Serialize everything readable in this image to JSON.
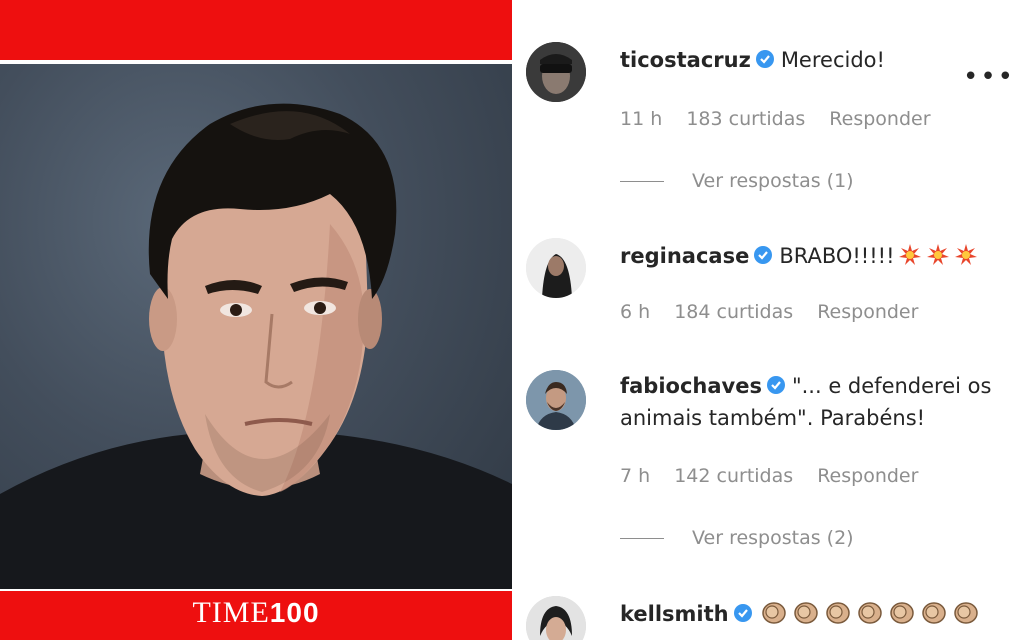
{
  "post": {
    "logo_word": "TIME",
    "logo_number": "100",
    "colors": {
      "banner_red": "#ee0f0f",
      "background": "#4a5563"
    }
  },
  "comments": [
    {
      "username": "ticostacruz",
      "text": "Merecido!",
      "emoji": "",
      "time": "11 h",
      "likes": "183 curtidas",
      "reply_label": "Responder",
      "view_replies": "Ver respostas (1)"
    },
    {
      "username": "reginacase",
      "text": "BRABO!!!!!",
      "emoji": "collision-emoji x3",
      "time": "6 h",
      "likes": "184 curtidas",
      "reply_label": "Responder",
      "view_replies": ""
    },
    {
      "username": "fabiochaves",
      "text": "\"... e defenderei os animais também\". Parabéns!",
      "emoji": "",
      "time": "7 h",
      "likes": "142 curtidas",
      "reply_label": "Responder",
      "view_replies": "Ver respostas (2)"
    },
    {
      "username": "kellsmith",
      "text": "",
      "emoji": "clapping-hands-emoji x7",
      "time": "",
      "likes": "",
      "reply_label": "",
      "view_replies": ""
    }
  ],
  "icons": {
    "more_options": "more-options-icon",
    "verified": "verified-badge-icon",
    "verified_color": "#3897f0"
  }
}
